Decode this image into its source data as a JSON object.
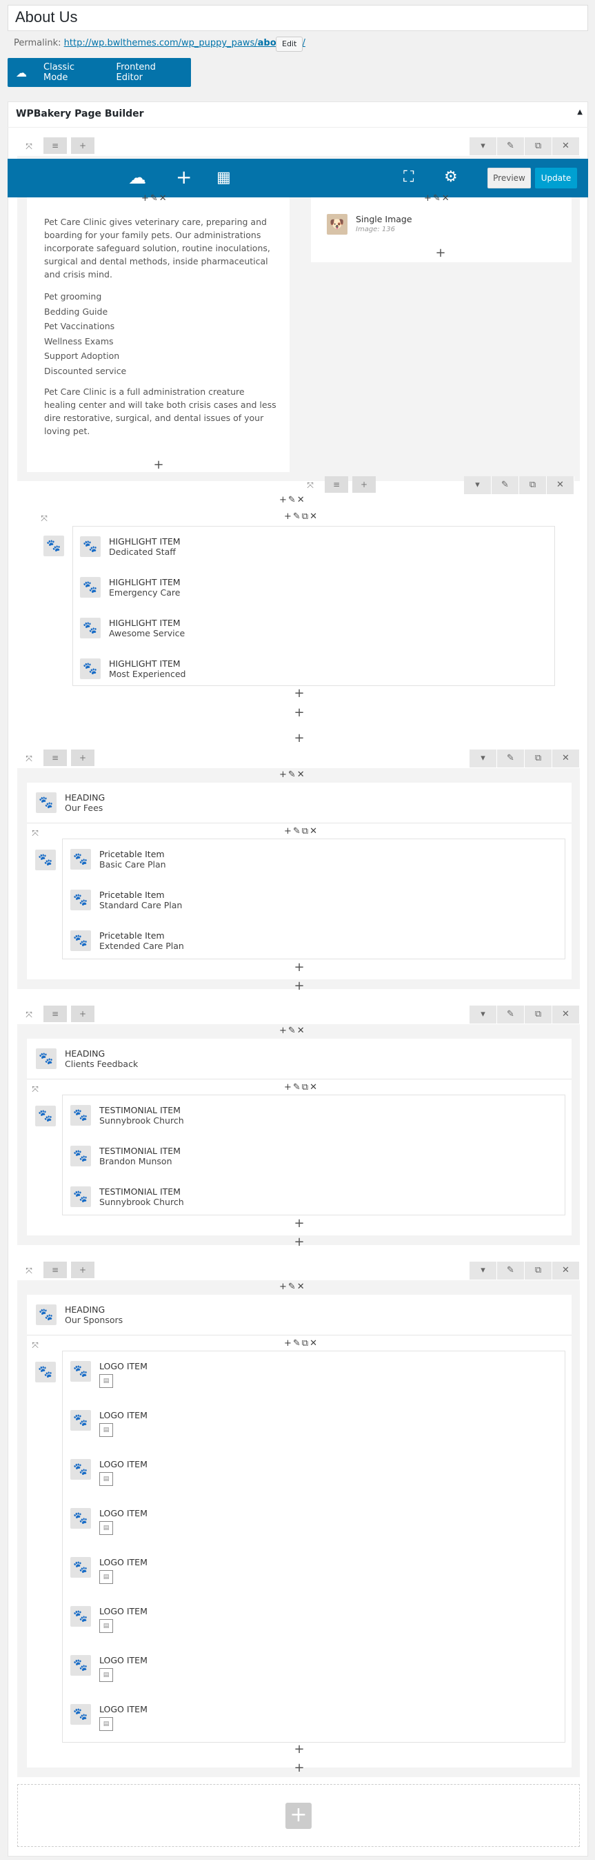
{
  "page_title": "About Us",
  "permalink": {
    "label": "Permalink:",
    "url_prefix": "http://wp.bwlthemes.com/wp_puppy_paws/",
    "slug": "about-us",
    "suffix": "/",
    "edit": "Edit"
  },
  "modes": {
    "classic": "Classic Mode",
    "frontend": "Frontend Editor"
  },
  "builder_title": "WPBakery Page Builder",
  "toolbar": {
    "preview": "Preview",
    "update": "Update"
  },
  "section1": {
    "paragraph1": "Pet Care Clinic gives veterinary care, preparing and boarding for your family pets. Our administrations incorporate safeguard solution, routine inoculations, surgical and dental methods, inside pharmaceutical and crisis mind.",
    "services": [
      "Pet grooming",
      "Bedding Guide",
      "Pet Vaccinations",
      "Wellness Exams",
      "Support Adoption",
      "Discounted service"
    ],
    "paragraph2": "Pet Care Clinic is a full administration creature healing center and will take both crisis cases and less dire restorative, surgical, and dental issues of your loving pet.",
    "single_image": {
      "title": "Single Image",
      "sub": "Image: 136"
    }
  },
  "highlights": [
    {
      "title": "HIGHLIGHT ITEM",
      "sub": "Dedicated Staff"
    },
    {
      "title": "HIGHLIGHT ITEM",
      "sub": "Emergency Care"
    },
    {
      "title": "HIGHLIGHT ITEM",
      "sub": "Awesome Service"
    },
    {
      "title": "HIGHLIGHT ITEM",
      "sub": "Most Experienced"
    }
  ],
  "fees": {
    "heading": "HEADING",
    "sub": "Our Fees",
    "items": [
      {
        "title": "Pricetable Item",
        "sub": "Basic Care Plan"
      },
      {
        "title": "Pricetable Item",
        "sub": "Standard Care Plan"
      },
      {
        "title": "Pricetable Item",
        "sub": "Extended Care Plan"
      }
    ]
  },
  "feedback": {
    "heading": "HEADING",
    "sub": "Clients Feedback",
    "items": [
      {
        "title": "TESTIMONIAL ITEM",
        "sub": "Sunnybrook Church"
      },
      {
        "title": "TESTIMONIAL ITEM",
        "sub": "Brandon Munson"
      },
      {
        "title": "TESTIMONIAL ITEM",
        "sub": "Sunnybrook Church"
      }
    ]
  },
  "sponsors": {
    "heading": "HEADING",
    "sub": "Our Sponsors",
    "logo_label": "LOGO ITEM",
    "count": 8
  },
  "colors": {
    "toolbar": "#0473aa",
    "update": "#00a0d2",
    "paw": "#3b6db3"
  }
}
